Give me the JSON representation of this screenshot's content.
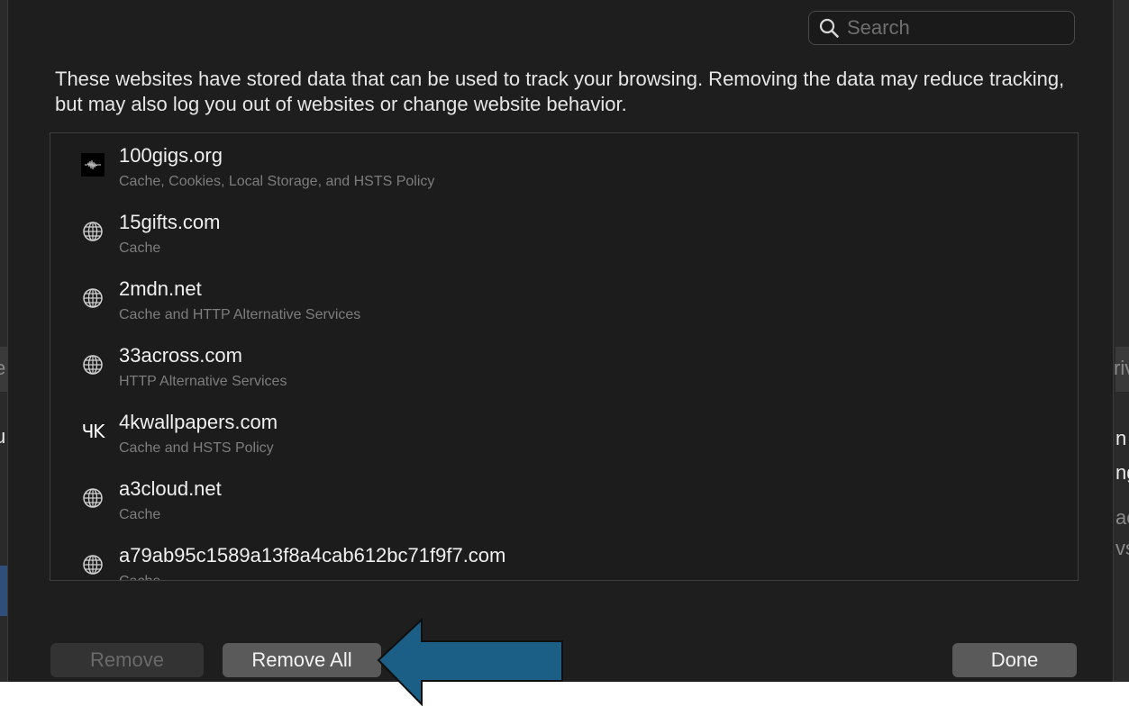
{
  "search": {
    "placeholder": "Search",
    "value": ""
  },
  "description": "These websites have stored data that can be used to track your browsing. Removing the data may reduce tracking, but may also log you out of websites or change website behavior.",
  "websites": [
    {
      "name": "100gigs.org",
      "detail": "Cache, Cookies, Local Storage, and HSTS Policy",
      "icon": "waveform-favicon-icon"
    },
    {
      "name": "15gifts.com",
      "detail": "Cache",
      "icon": "globe-icon"
    },
    {
      "name": "2mdn.net",
      "detail": "Cache and HTTP Alternative Services",
      "icon": "globe-icon"
    },
    {
      "name": "33across.com",
      "detail": "HTTP Alternative Services",
      "icon": "globe-icon"
    },
    {
      "name": "4kwallpapers.com",
      "detail": "Cache and HSTS Policy",
      "icon": "4k-favicon-icon",
      "favicon_text": "ЧK"
    },
    {
      "name": "a3cloud.net",
      "detail": "Cache",
      "icon": "globe-icon"
    },
    {
      "name": "a79ab95c1589a13f8a4cab612bc71f9f7.com",
      "detail": "Cache",
      "icon": "globe-icon"
    }
  ],
  "buttons": {
    "remove": "Remove",
    "remove_all": "Remove All",
    "done": "Done"
  },
  "annotation": {
    "arrow_color": "#1b5f87",
    "arrow_direction": "left",
    "points_to": "Remove All"
  },
  "background_fragments": {
    "left_strip": "e",
    "right_strip": "riv",
    "left_mid": "u",
    "right_lines": [
      "n",
      "ng",
      "ac",
      "vs"
    ]
  },
  "colors": {
    "sheet_background": "#1e1e1e",
    "text_primary": "#f0f0f0",
    "text_secondary": "#7d7d7d",
    "button_default": "#5a5a5a",
    "button_disabled": "#333333"
  }
}
